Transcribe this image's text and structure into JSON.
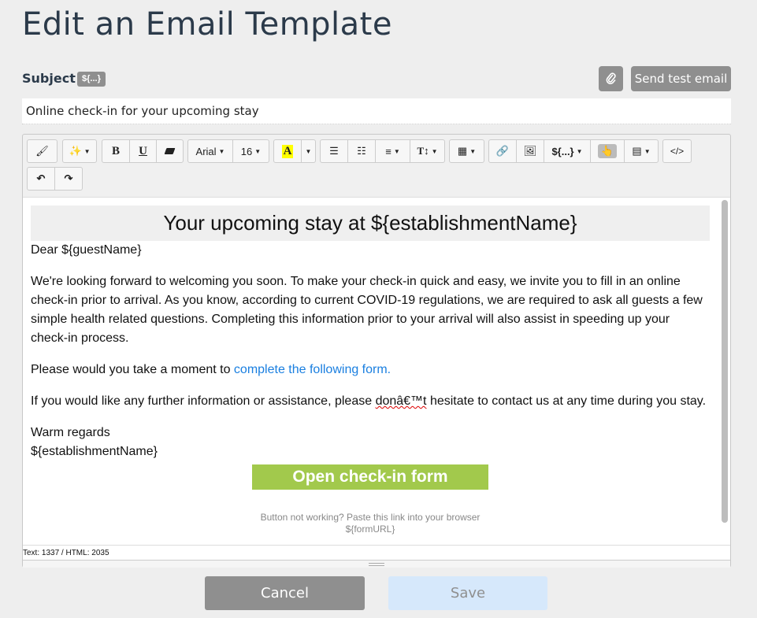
{
  "page_title": "Edit an Email Template",
  "subject": {
    "label": "Subject",
    "variable_badge": "${...}",
    "value": "Online check-in for your upcoming stay"
  },
  "header_actions": {
    "attach_icon": "paperclip-icon",
    "send_test_label": "Send test email"
  },
  "toolbar": {
    "font_family": "Arial",
    "font_size": "16",
    "color_label": "A",
    "variables_label": "${...}",
    "code_label": "</>",
    "highlight_color": "#ffff00"
  },
  "content": {
    "heading": "Your upcoming stay at ${establishmentName}",
    "greeting": "Dear ${guestName}",
    "paragraph1": "We're looking forward to welcoming you soon. To make your check-in quick and easy, we invite you to fill in an online check-in prior to arrival. As you know, according to current COVID-19 regulations, we are required to ask all guests a few simple health related questions. Completing this information prior to your arrival will also assist in speeding up your check-in process.",
    "paragraph2_prefix": "Please would you take a moment to ",
    "paragraph2_link": "complete the following form.",
    "paragraph3_before": "If you would like any further information or assistance, please ",
    "paragraph3_misspelled": "donâ€™t",
    "paragraph3_after": " hesitate to contact us at any time during you stay.",
    "signoff": "Warm regards",
    "signature": "${establishmentName}",
    "cta_label": "Open check-in form",
    "cta_color": "#a2c94c",
    "fallback_text": "Button not working? Paste this link into your browser",
    "fallback_link": "${formURL}"
  },
  "status_bar": "Text: 1337 / HTML: 2035",
  "footer": {
    "cancel_label": "Cancel",
    "save_label": "Save"
  }
}
